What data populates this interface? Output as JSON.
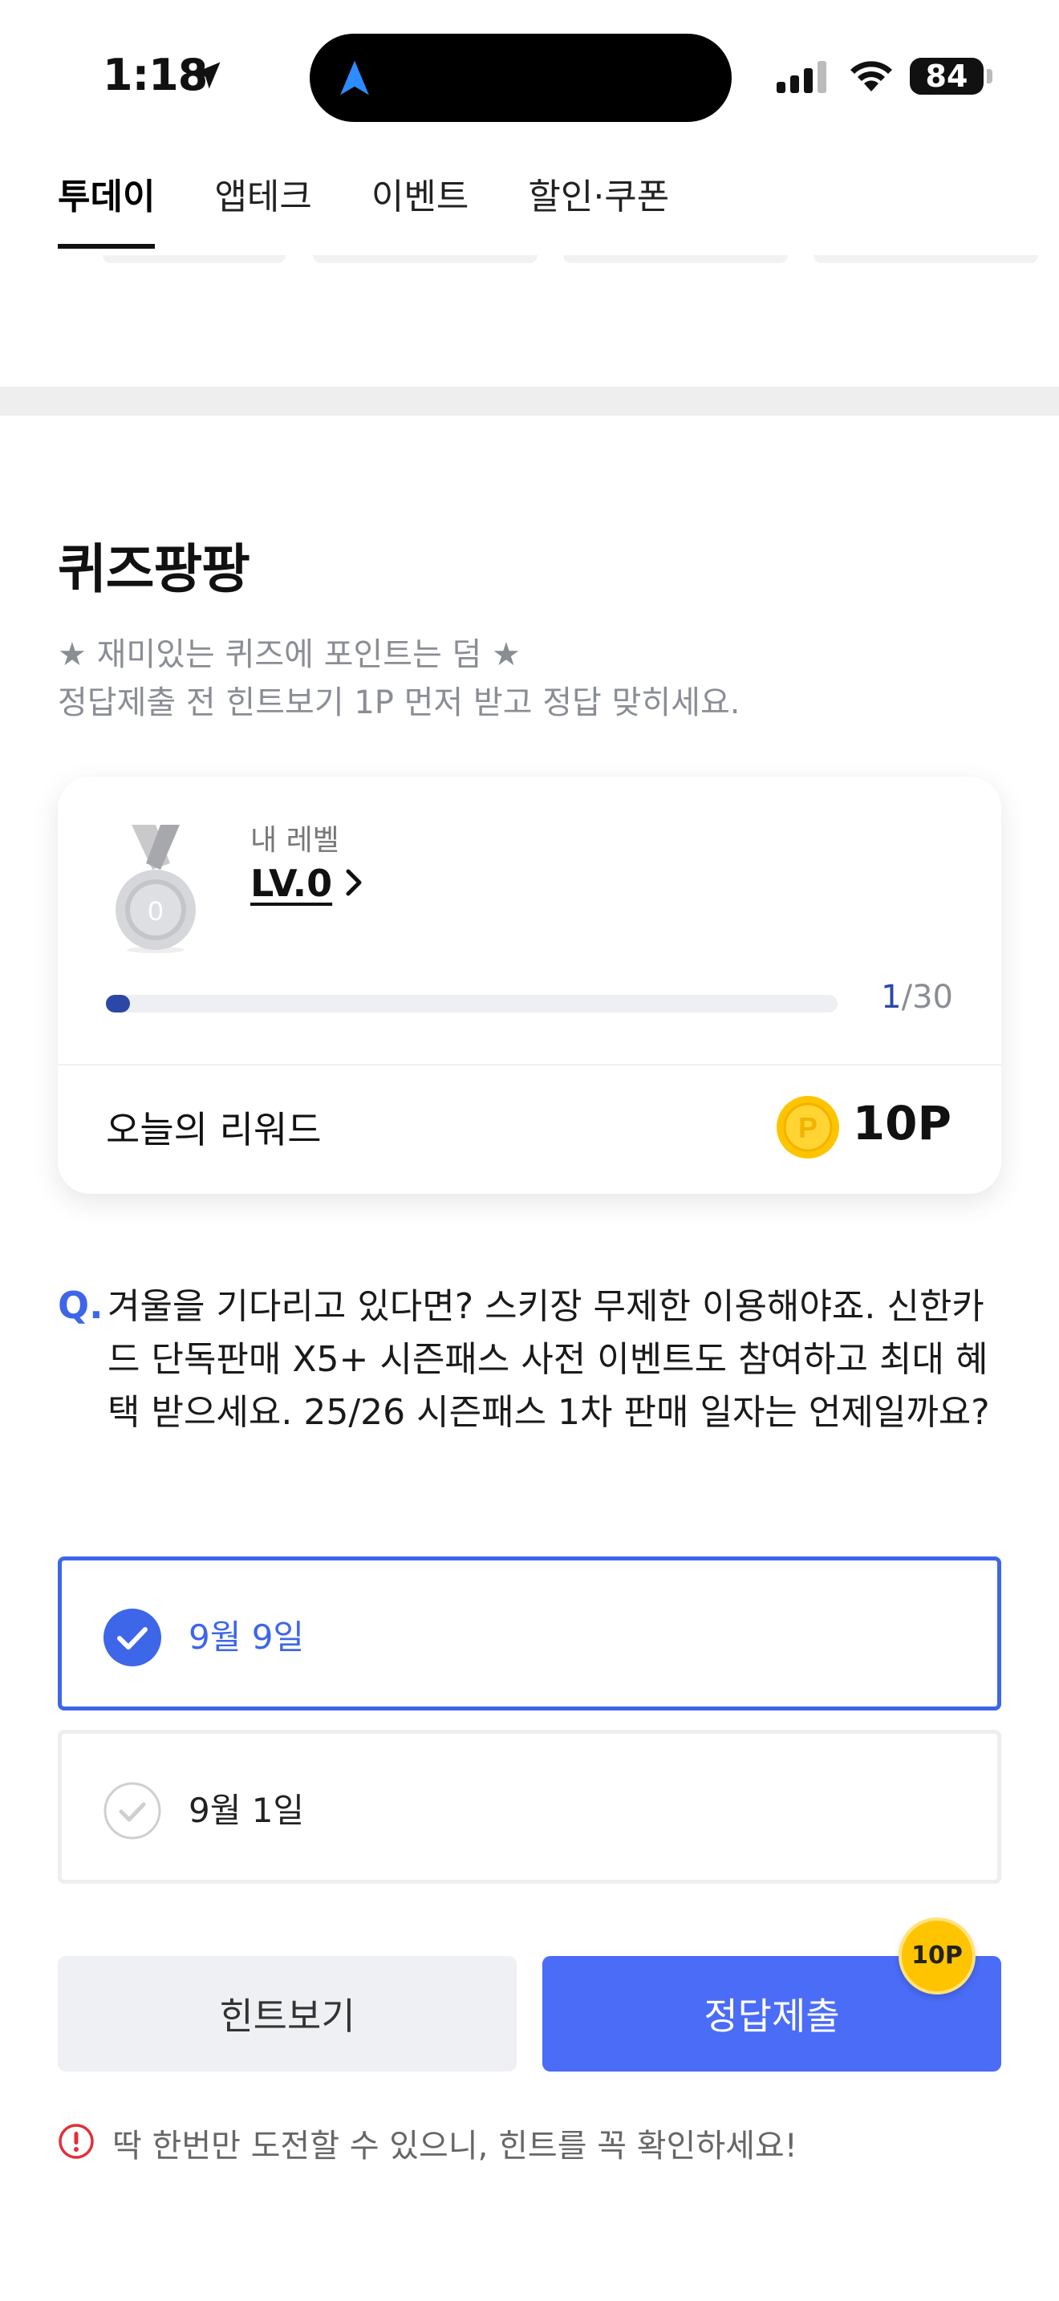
{
  "status_bar": {
    "time": "1:18",
    "battery": "84"
  },
  "tabs": [
    {
      "label": "투데이",
      "active": true
    },
    {
      "label": "앱테크",
      "active": false
    },
    {
      "label": "이벤트",
      "active": false
    },
    {
      "label": "할인·쿠폰",
      "active": false
    }
  ],
  "quiz": {
    "title": "퀴즈팡팡",
    "description": "★ 재미있는 퀴즈에 포인트는 덤 ★\n정답제출 전 힌트보기 1P 먼저 받고 정답 맞히세요."
  },
  "level_card": {
    "medal_number": "0",
    "level_label": "내 레벨",
    "level_value": "LV.0",
    "progress_current": "1",
    "progress_total": "/30",
    "progress_fraction": 0.033,
    "reward_label": "오늘의 리워드",
    "coin_symbol": "P",
    "reward_value": "10P"
  },
  "question": {
    "mark": "Q.",
    "text": "겨울을 기다리고 있다면? 스키장 무제한 이용해야죠. 신한카드 단독판매 X5+ 시즌패스 사전 이벤트도 참여하고 최대 혜택 받으세요. 25/26 시즌패스 1차 판매 일자는 언제일까요?"
  },
  "options": [
    {
      "label": "9월 9일",
      "selected": true
    },
    {
      "label": "9월 1일",
      "selected": false
    }
  ],
  "buttons": {
    "hint_label": "힌트보기",
    "submit_label": "정답제출",
    "submit_badge": "10P"
  },
  "warning": {
    "text": "딱 한번만 도전할 수 있으니, 힌트를 꼭 확인하세요!"
  },
  "colors": {
    "accent": "#4a6cf7",
    "question_mark": "#3d66e8",
    "progress": "#2b48a6",
    "coin": "#ffc400",
    "warning": "#e0303a"
  }
}
